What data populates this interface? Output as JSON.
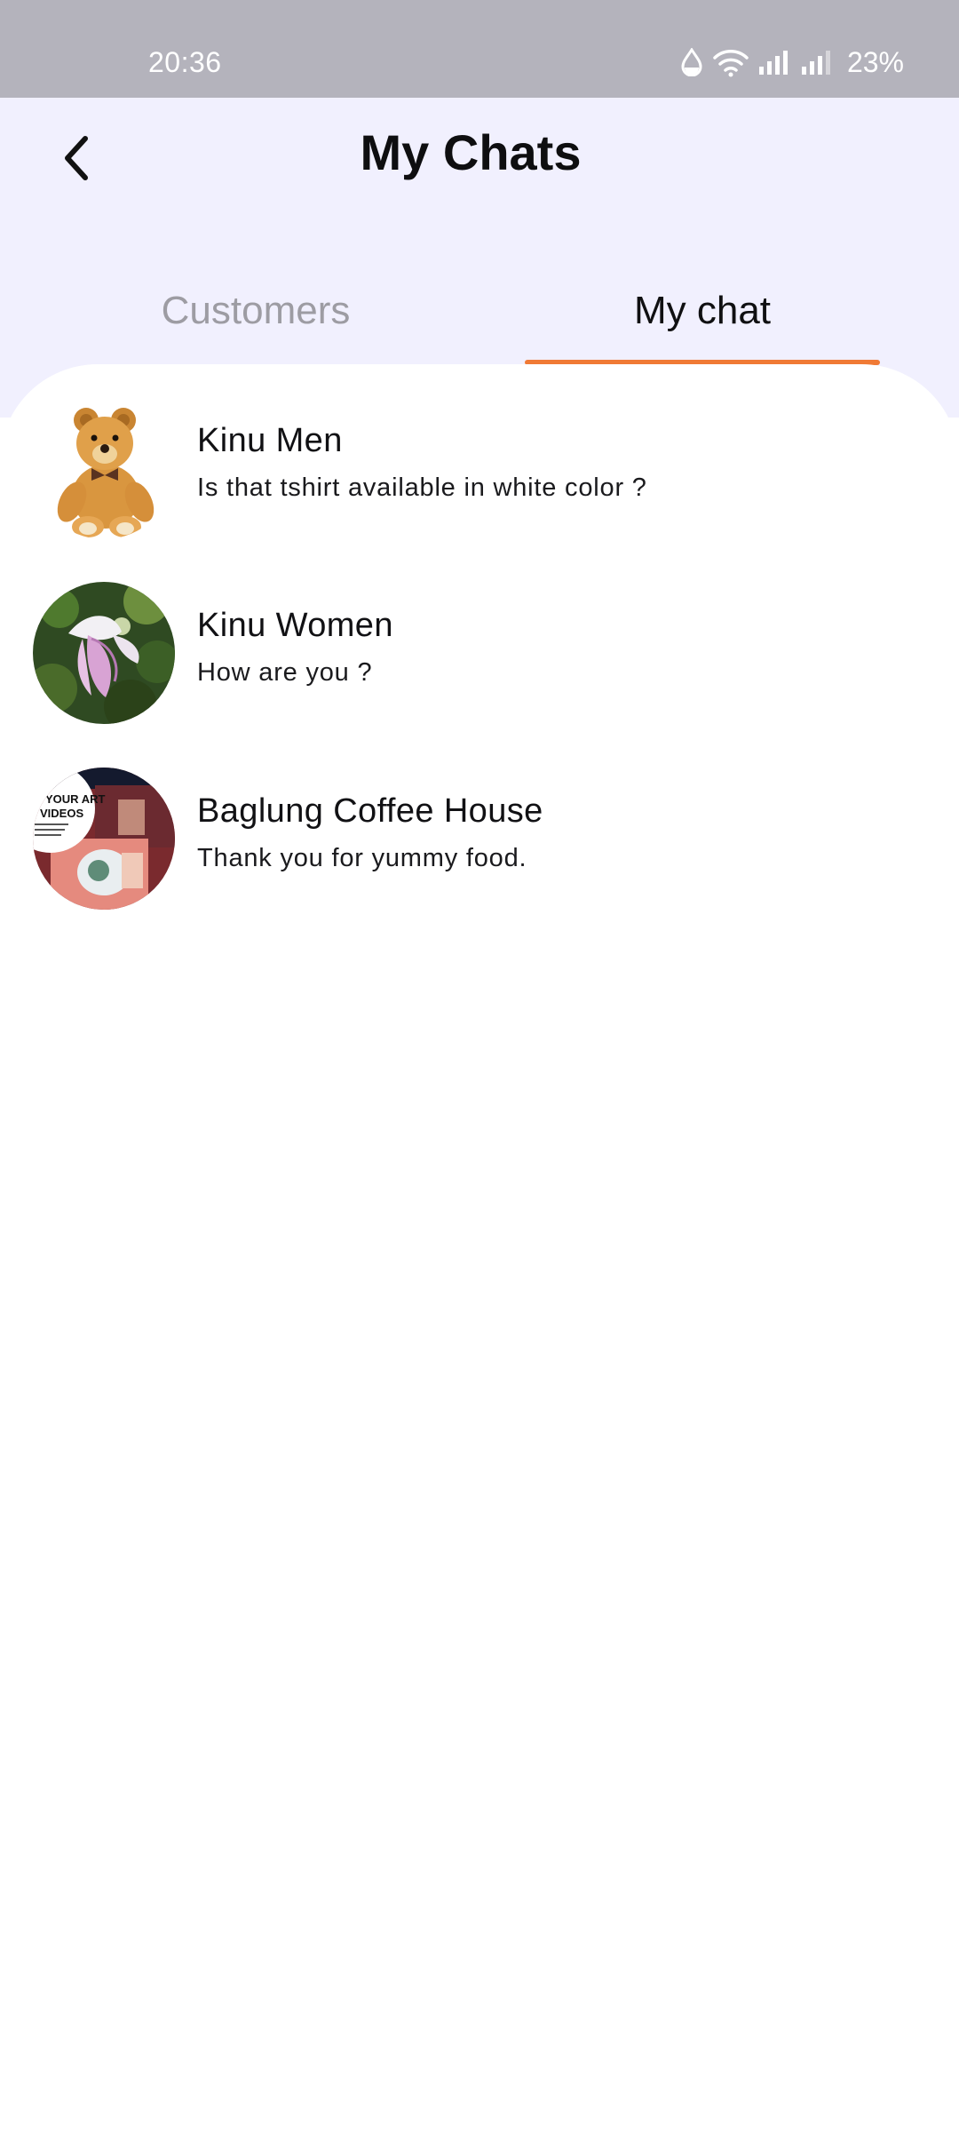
{
  "status_bar": {
    "time": "20:36",
    "battery": "23%",
    "icons": [
      "data-saver-icon",
      "wifi-icon",
      "signal-icon",
      "signal-icon",
      "battery-percent"
    ]
  },
  "header": {
    "title": "My Chats",
    "back_icon": "chevron-left-icon"
  },
  "tabs": [
    {
      "label": "Customers",
      "active": false
    },
    {
      "label": "My chat",
      "active": true
    }
  ],
  "colors": {
    "accent": "#f07a35",
    "header_bg": "#f1f0fe",
    "status_bar_bg": "#b4b3bc",
    "inactive_tab": "#9d9ca3"
  },
  "chats": [
    {
      "name": "Kinu Men",
      "preview": "Is that tshirt available in white color ?",
      "avatar": "teddy-bear-photo"
    },
    {
      "name": "Kinu Women",
      "preview": "How are you ?",
      "avatar": "flower-photo"
    },
    {
      "name": "Baglung Coffee House",
      "preview": "Thank you for yummy food.",
      "avatar": "art-videos-photo",
      "avatar_text": [
        "YOUR ART",
        "VIDEOS"
      ]
    }
  ]
}
